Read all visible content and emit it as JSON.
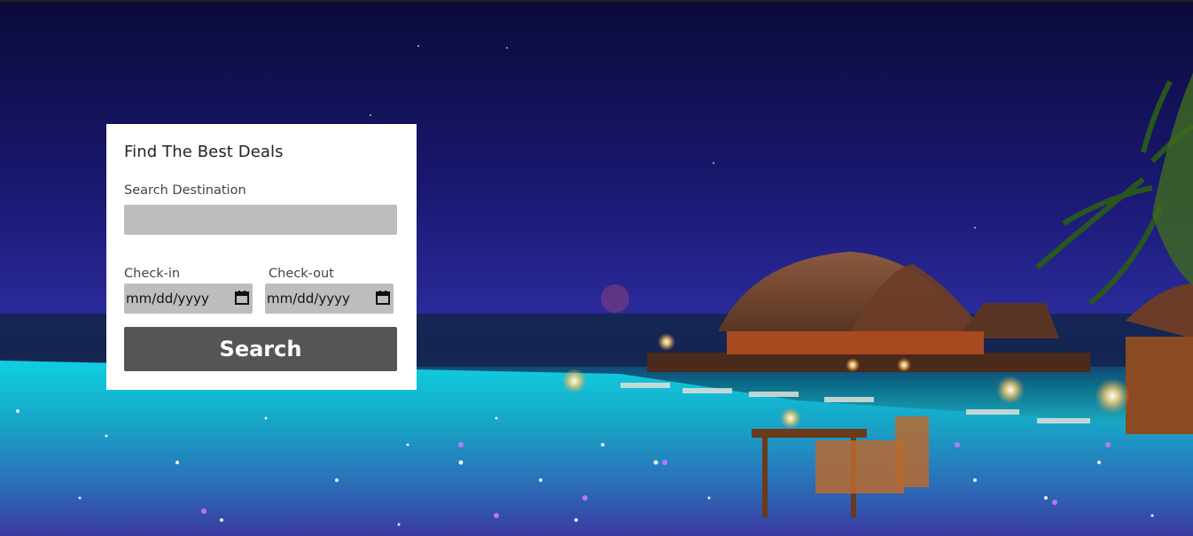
{
  "hero": {
    "image_icon": "resort-pool-night-photo"
  },
  "search_card": {
    "title": "Find The Best Deals",
    "destination": {
      "label": "Search Destination",
      "value": "",
      "placeholder": ""
    },
    "checkin": {
      "label": "Check-in",
      "value": "mm/dd/yyyy",
      "icon": "calendar-icon"
    },
    "checkout": {
      "label": "Check-out",
      "value": "mm/dd/yyyy",
      "icon": "calendar-icon"
    },
    "search_button_label": "Search"
  },
  "colors": {
    "card_background": "#ffffff",
    "input_background": "#bdbdbd",
    "button_background": "#555555",
    "button_text": "#ffffff"
  }
}
